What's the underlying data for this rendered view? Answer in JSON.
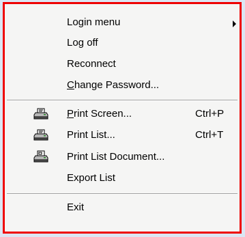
{
  "menu": {
    "items": [
      {
        "name": "login-menu-item",
        "label": "Login menu",
        "submenu": true
      },
      {
        "name": "log-off-item",
        "label": "Log off"
      },
      {
        "name": "reconnect-item",
        "label": "Reconnect"
      },
      {
        "name": "change-password-item",
        "label_prefix": "C",
        "label_rest": "hange Password..."
      }
    ],
    "print_items": [
      {
        "name": "print-screen-item",
        "label_prefix": "P",
        "label_rest": "rint Screen...",
        "shortcut": "Ctrl+P",
        "icon": "printer-icon"
      },
      {
        "name": "print-list-item",
        "label": "Print List...",
        "shortcut": "Ctrl+T",
        "icon": "printer-icon"
      },
      {
        "name": "print-list-document-item",
        "label": "Print List Document...",
        "icon": "printer-document-icon"
      },
      {
        "name": "export-list-item",
        "label": "Export List"
      }
    ],
    "exit": {
      "label": "Exit"
    }
  },
  "colors": {
    "border": "#ee0000",
    "menu_bg": "#f5f5f4",
    "page_bg": "#dbe6f3"
  }
}
